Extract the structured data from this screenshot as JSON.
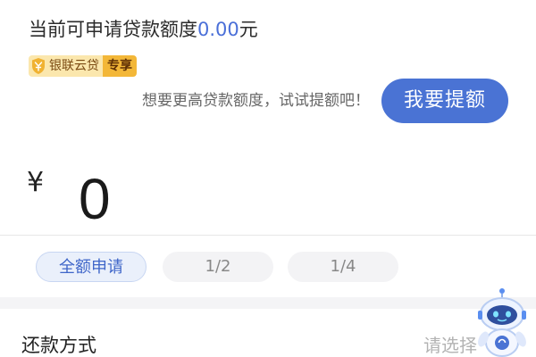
{
  "quota": {
    "label": "当前可申请贷款额度",
    "amount": "0.00",
    "unit": "元"
  },
  "badge": {
    "brand": "银联云贷",
    "tag": "专享"
  },
  "promo": {
    "hint": "想要更高贷款额度，试试提额吧！",
    "button_label": "我要提额"
  },
  "loan_amount": {
    "currency": "¥",
    "value": "0"
  },
  "amount_options": [
    {
      "label": "全额申请",
      "selected": true
    },
    {
      "label": "1/2",
      "selected": false
    },
    {
      "label": "1/4",
      "selected": false
    }
  ],
  "repayment": {
    "label": "还款方式",
    "placeholder": "请选择"
  },
  "assistant": {
    "icon": "robot-assistant-icon"
  },
  "colors": {
    "accent": "#4a73d4",
    "amount_text": "#4a6fd8",
    "badge_gold": "#f3b738",
    "badge_light": "#fbe7ad"
  }
}
